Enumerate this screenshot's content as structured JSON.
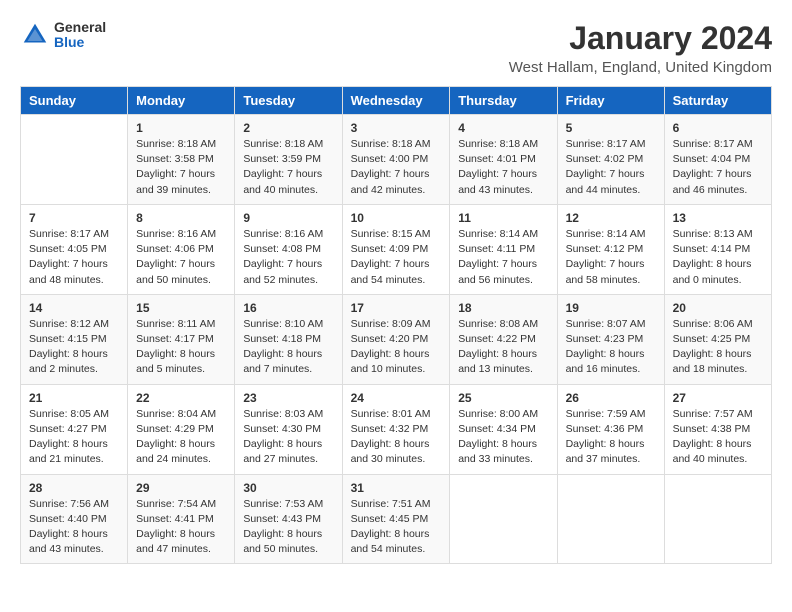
{
  "header": {
    "logo_general": "General",
    "logo_blue": "Blue",
    "month_title": "January 2024",
    "location": "West Hallam, England, United Kingdom"
  },
  "weekdays": [
    "Sunday",
    "Monday",
    "Tuesday",
    "Wednesday",
    "Thursday",
    "Friday",
    "Saturday"
  ],
  "weeks": [
    [
      {
        "day": "",
        "sunrise": "",
        "sunset": "",
        "daylight": ""
      },
      {
        "day": "1",
        "sunrise": "8:18 AM",
        "sunset": "3:58 PM",
        "daylight": "7 hours and 39 minutes."
      },
      {
        "day": "2",
        "sunrise": "8:18 AM",
        "sunset": "3:59 PM",
        "daylight": "7 hours and 40 minutes."
      },
      {
        "day": "3",
        "sunrise": "8:18 AM",
        "sunset": "4:00 PM",
        "daylight": "7 hours and 42 minutes."
      },
      {
        "day": "4",
        "sunrise": "8:18 AM",
        "sunset": "4:01 PM",
        "daylight": "7 hours and 43 minutes."
      },
      {
        "day": "5",
        "sunrise": "8:17 AM",
        "sunset": "4:02 PM",
        "daylight": "7 hours and 44 minutes."
      },
      {
        "day": "6",
        "sunrise": "8:17 AM",
        "sunset": "4:04 PM",
        "daylight": "7 hours and 46 minutes."
      }
    ],
    [
      {
        "day": "7",
        "sunrise": "8:17 AM",
        "sunset": "4:05 PM",
        "daylight": "7 hours and 48 minutes."
      },
      {
        "day": "8",
        "sunrise": "8:16 AM",
        "sunset": "4:06 PM",
        "daylight": "7 hours and 50 minutes."
      },
      {
        "day": "9",
        "sunrise": "8:16 AM",
        "sunset": "4:08 PM",
        "daylight": "7 hours and 52 minutes."
      },
      {
        "day": "10",
        "sunrise": "8:15 AM",
        "sunset": "4:09 PM",
        "daylight": "7 hours and 54 minutes."
      },
      {
        "day": "11",
        "sunrise": "8:14 AM",
        "sunset": "4:11 PM",
        "daylight": "7 hours and 56 minutes."
      },
      {
        "day": "12",
        "sunrise": "8:14 AM",
        "sunset": "4:12 PM",
        "daylight": "7 hours and 58 minutes."
      },
      {
        "day": "13",
        "sunrise": "8:13 AM",
        "sunset": "4:14 PM",
        "daylight": "8 hours and 0 minutes."
      }
    ],
    [
      {
        "day": "14",
        "sunrise": "8:12 AM",
        "sunset": "4:15 PM",
        "daylight": "8 hours and 2 minutes."
      },
      {
        "day": "15",
        "sunrise": "8:11 AM",
        "sunset": "4:17 PM",
        "daylight": "8 hours and 5 minutes."
      },
      {
        "day": "16",
        "sunrise": "8:10 AM",
        "sunset": "4:18 PM",
        "daylight": "8 hours and 7 minutes."
      },
      {
        "day": "17",
        "sunrise": "8:09 AM",
        "sunset": "4:20 PM",
        "daylight": "8 hours and 10 minutes."
      },
      {
        "day": "18",
        "sunrise": "8:08 AM",
        "sunset": "4:22 PM",
        "daylight": "8 hours and 13 minutes."
      },
      {
        "day": "19",
        "sunrise": "8:07 AM",
        "sunset": "4:23 PM",
        "daylight": "8 hours and 16 minutes."
      },
      {
        "day": "20",
        "sunrise": "8:06 AM",
        "sunset": "4:25 PM",
        "daylight": "8 hours and 18 minutes."
      }
    ],
    [
      {
        "day": "21",
        "sunrise": "8:05 AM",
        "sunset": "4:27 PM",
        "daylight": "8 hours and 21 minutes."
      },
      {
        "day": "22",
        "sunrise": "8:04 AM",
        "sunset": "4:29 PM",
        "daylight": "8 hours and 24 minutes."
      },
      {
        "day": "23",
        "sunrise": "8:03 AM",
        "sunset": "4:30 PM",
        "daylight": "8 hours and 27 minutes."
      },
      {
        "day": "24",
        "sunrise": "8:01 AM",
        "sunset": "4:32 PM",
        "daylight": "8 hours and 30 minutes."
      },
      {
        "day": "25",
        "sunrise": "8:00 AM",
        "sunset": "4:34 PM",
        "daylight": "8 hours and 33 minutes."
      },
      {
        "day": "26",
        "sunrise": "7:59 AM",
        "sunset": "4:36 PM",
        "daylight": "8 hours and 37 minutes."
      },
      {
        "day": "27",
        "sunrise": "7:57 AM",
        "sunset": "4:38 PM",
        "daylight": "8 hours and 40 minutes."
      }
    ],
    [
      {
        "day": "28",
        "sunrise": "7:56 AM",
        "sunset": "4:40 PM",
        "daylight": "8 hours and 43 minutes."
      },
      {
        "day": "29",
        "sunrise": "7:54 AM",
        "sunset": "4:41 PM",
        "daylight": "8 hours and 47 minutes."
      },
      {
        "day": "30",
        "sunrise": "7:53 AM",
        "sunset": "4:43 PM",
        "daylight": "8 hours and 50 minutes."
      },
      {
        "day": "31",
        "sunrise": "7:51 AM",
        "sunset": "4:45 PM",
        "daylight": "8 hours and 54 minutes."
      },
      {
        "day": "",
        "sunrise": "",
        "sunset": "",
        "daylight": ""
      },
      {
        "day": "",
        "sunrise": "",
        "sunset": "",
        "daylight": ""
      },
      {
        "day": "",
        "sunrise": "",
        "sunset": "",
        "daylight": ""
      }
    ]
  ]
}
